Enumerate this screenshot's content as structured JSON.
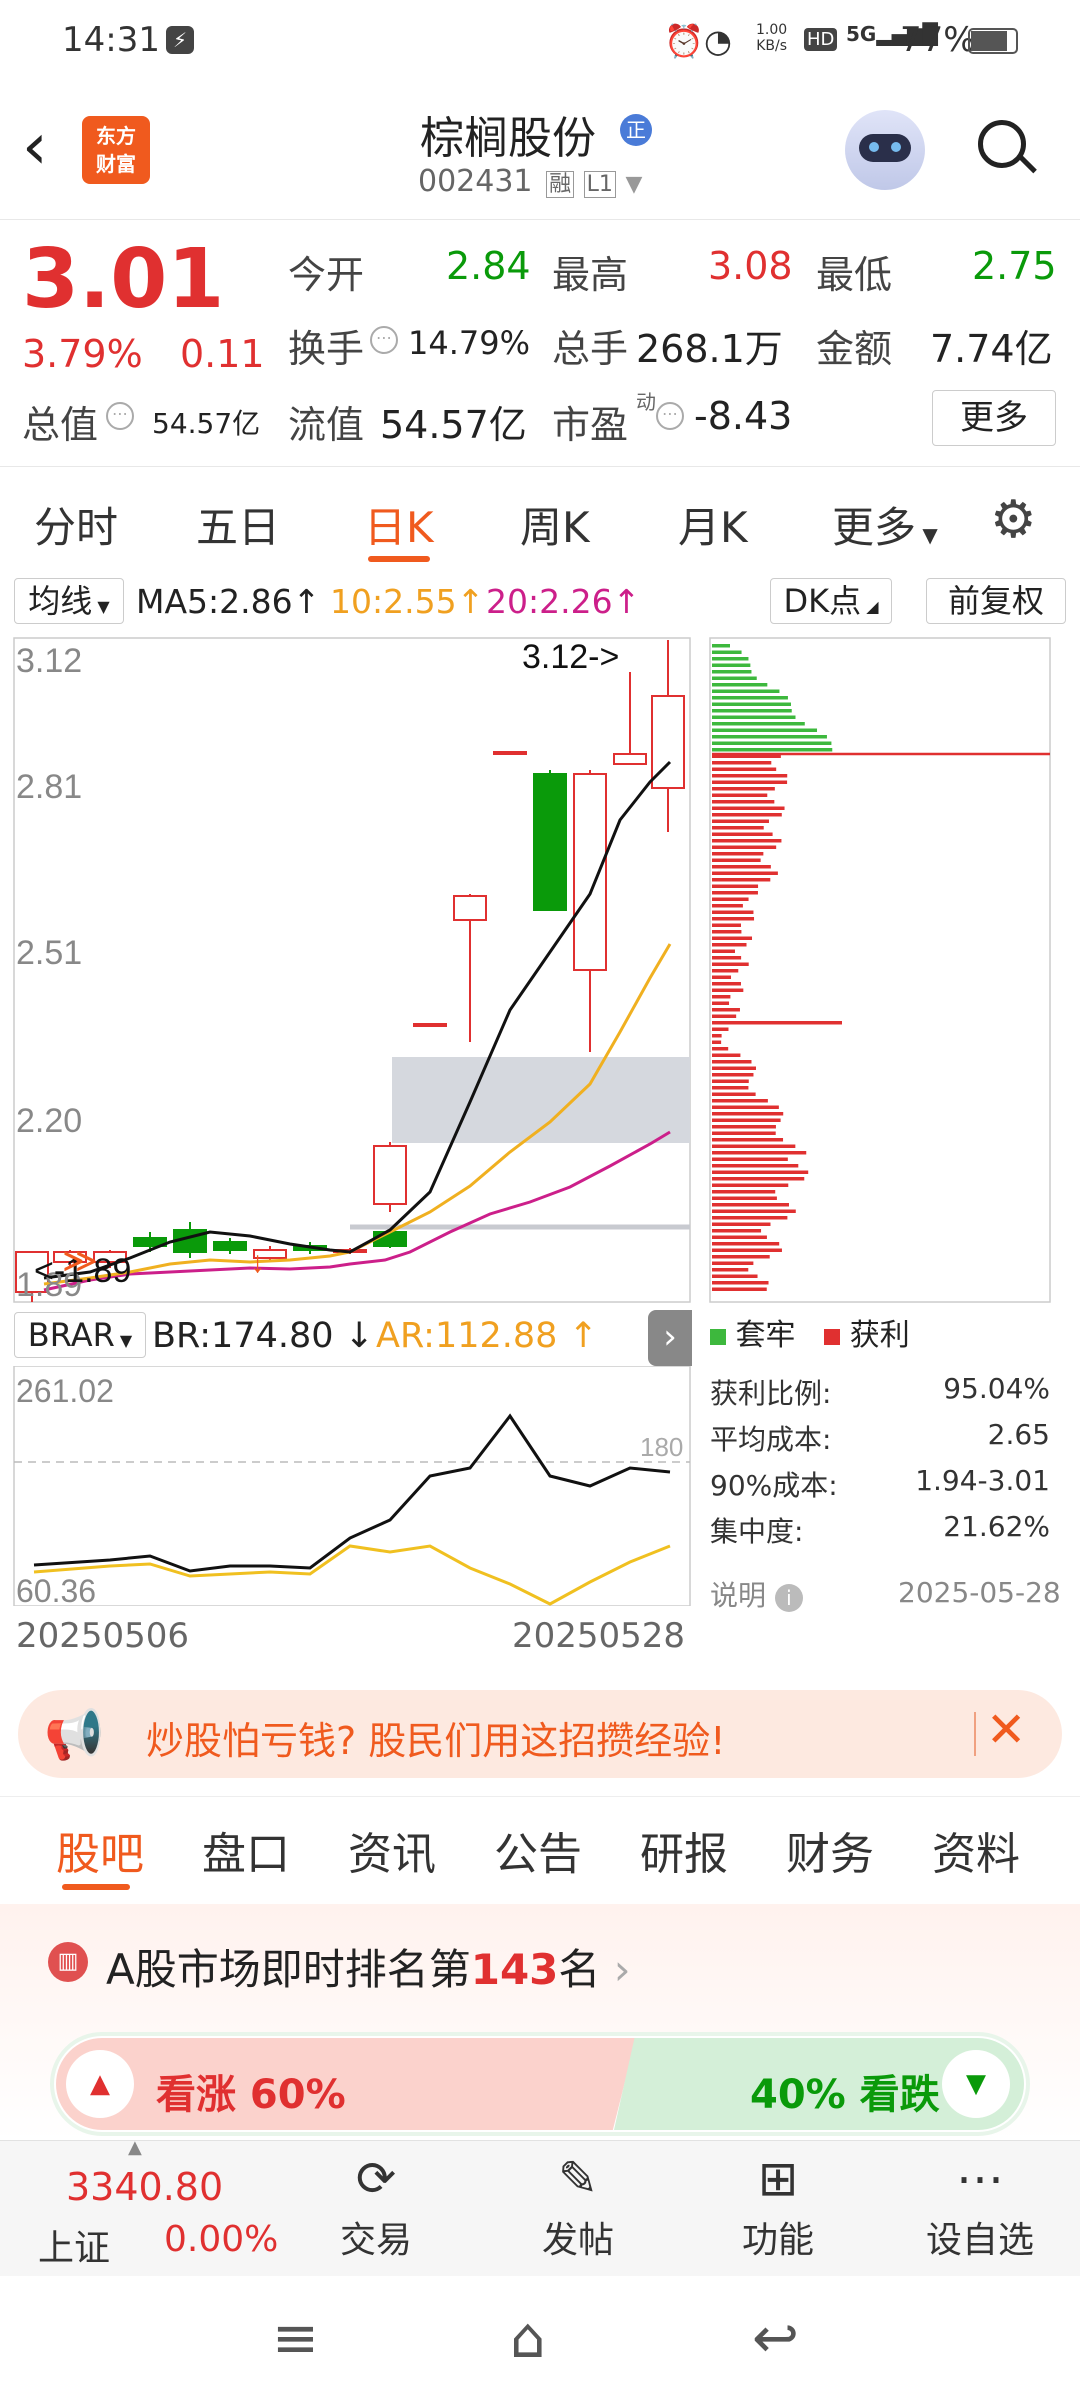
{
  "status_bar": {
    "time": "14:31",
    "speed": "1.00",
    "speed_unit": "KB/s",
    "hd": "HD",
    "network": "5G",
    "battery": "77%"
  },
  "header": {
    "logo_line1": "东方",
    "logo_line2": "财富",
    "title": "棕榈股份",
    "title_badge": "正",
    "code": "002431",
    "tag1": "融",
    "tag2": "L1"
  },
  "quote": {
    "price": "3.01",
    "change_pct": "3.79%",
    "change_abs": "0.11",
    "open_label": "今开",
    "open": "2.84",
    "high_label": "最高",
    "high": "3.08",
    "low_label": "最低",
    "low": "2.75",
    "turnover_label": "换手",
    "turnover": "14.79%",
    "volume_label": "总手",
    "volume": "268.1万",
    "amount_label": "金额",
    "amount": "7.74亿",
    "mktcap_label": "总值",
    "mktcap": "54.57亿",
    "float_label": "流值",
    "float_cap": "54.57亿",
    "pe_label": "市盈",
    "pe_sup": "动",
    "pe": "-8.43",
    "more": "更多"
  },
  "period_tabs": [
    "分时",
    "五日",
    "日K",
    "周K",
    "月K",
    "更多"
  ],
  "active_tab": "日K",
  "ma": {
    "selector": "均线",
    "ma5": "MA5:2.86",
    "ma10": "10:2.55",
    "ma20": "20:2.26",
    "dk": "DK点",
    "adjust": "前复权"
  },
  "price_axis": {
    "p1": "3.12",
    "p2": "2.81",
    "p3": "2.51",
    "p4": "2.20",
    "p5": "1.89"
  },
  "annotations": {
    "high_mark": "3.12->",
    "low_mark": "<-1.89"
  },
  "indicator": {
    "selector": "BRAR",
    "br": "BR:174.80",
    "ar": "AR:112.88",
    "ymax": "261.02",
    "ymin": "60.36",
    "ref": "180",
    "date_start": "20250506",
    "date_end": "20250528"
  },
  "chip": {
    "legend_trapped": "套牢",
    "legend_profit": "获利",
    "rows": [
      {
        "label": "获利比例:",
        "value": "95.04%"
      },
      {
        "label": "平均成本:",
        "value": "2.65"
      },
      {
        "label": "90%成本:",
        "value": "1.94-3.01"
      },
      {
        "label": "集中度:",
        "value": "21.62%"
      }
    ],
    "note": "说明",
    "date": "2025-05-28"
  },
  "banner": {
    "text": "炒股怕亏钱? 股民们用这招攒经验!"
  },
  "section_tabs": [
    "股吧",
    "盘口",
    "资讯",
    "公告",
    "研报",
    "财务",
    "资料"
  ],
  "ranking": {
    "prefix": "A股市场即时排名第",
    "rank": "143",
    "suffix": "名"
  },
  "vote": {
    "bull": "看涨 60%",
    "bear": "40% 看跌",
    "bull_pct": 60
  },
  "bottom_nav": {
    "index_value": "3340.80",
    "index_name": "上证",
    "index_change": "0.00%",
    "trade": "交易",
    "post": "发帖",
    "func": "功能",
    "watch": "设自选"
  },
  "colors": {
    "up": "#e03030",
    "down": "#0a9a0a",
    "accent": "#f05a1e"
  }
}
